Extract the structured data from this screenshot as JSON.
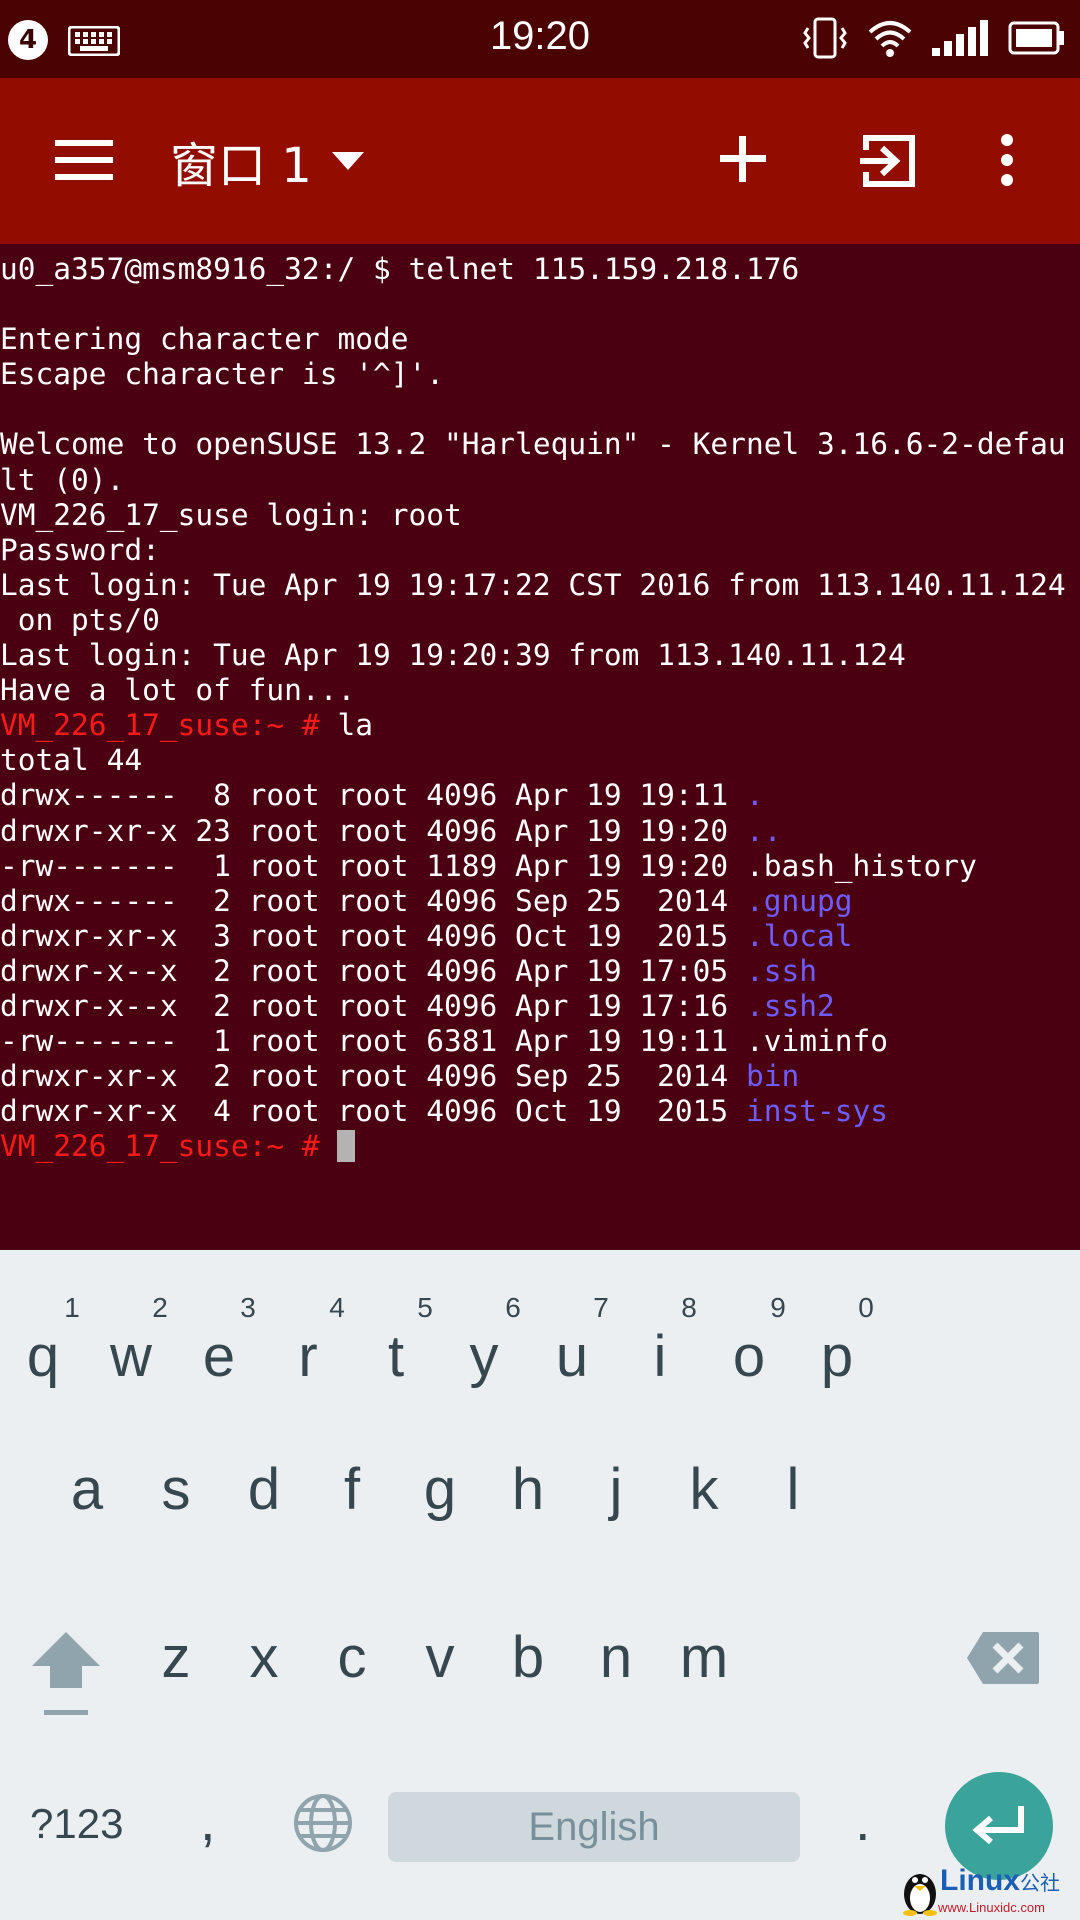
{
  "status_bar": {
    "notification_count": "4",
    "time": "19:20",
    "icons": [
      "keyboard-icon",
      "vibrate-icon",
      "wifi-icon",
      "signal-icon",
      "battery-icon"
    ]
  },
  "app_bar": {
    "window_label": "窗口 1",
    "actions": [
      "add-icon",
      "exit-icon",
      "more-icon"
    ],
    "background": "#920d00"
  },
  "terminal": {
    "background": "#4a0011",
    "prompt_color": "#ff1a1a",
    "dir_color": "#6f5cff",
    "lines": [
      {
        "text": "u0_a357@msm8916_32:/ $ telnet 115.159.218.176"
      },
      {
        "text": ""
      },
      {
        "text": "Entering character mode"
      },
      {
        "text": "Escape character is '^]'."
      },
      {
        "text": ""
      },
      {
        "text": "Welcome to openSUSE 13.2 \"Harlequin\" - Kernel 3.16.6-2-defau"
      },
      {
        "text": "lt (0)."
      },
      {
        "text": "VM_226_17_suse login: root"
      },
      {
        "text": "Password:"
      },
      {
        "text": "Last login: Tue Apr 19 19:17:22 CST 2016 from 113.140.11.124"
      },
      {
        "text": " on pts/0"
      },
      {
        "text": "Last login: Tue Apr 19 19:20:39 from 113.140.11.124"
      },
      {
        "text": "Have a lot of fun..."
      },
      {
        "prompt": "VM_226_17_suse:~ #",
        "text": " la"
      },
      {
        "text": "total 44"
      },
      {
        "text": "drwx------  8 root root 4096 Apr 19 19:11 ",
        "dir": "."
      },
      {
        "text": "drwxr-xr-x 23 root root 4096 Apr 19 19:20 ",
        "dir": ".."
      },
      {
        "text": "-rw-------  1 root root 1189 Apr 19 19:20 .bash_history"
      },
      {
        "text": "drwx------  2 root root 4096 Sep 25  2014 ",
        "dir": ".gnupg"
      },
      {
        "text": "drwxr-xr-x  3 root root 4096 Oct 19  2015 ",
        "dir": ".local"
      },
      {
        "text": "drwxr-x--x  2 root root 4096 Apr 19 17:05 ",
        "dir": ".ssh"
      },
      {
        "text": "drwxr-x--x  2 root root 4096 Apr 19 17:16 ",
        "dir": ".ssh2"
      },
      {
        "text": "-rw-------  1 root root 6381 Apr 19 19:11 .viminfo"
      },
      {
        "text": "drwxr-xr-x  2 root root 4096 Sep 25  2014 ",
        "dir": "bin"
      },
      {
        "text": "drwxr-xr-x  4 root root 4096 Oct 19  2015 ",
        "dir": "inst-sys"
      },
      {
        "prompt": "VM_226_17_suse:~ #",
        "text": " ",
        "cursor": true
      }
    ]
  },
  "keyboard": {
    "row1": [
      {
        "key": "q",
        "hint": "1"
      },
      {
        "key": "w",
        "hint": "2"
      },
      {
        "key": "e",
        "hint": "3"
      },
      {
        "key": "r",
        "hint": "4"
      },
      {
        "key": "t",
        "hint": "5"
      },
      {
        "key": "y",
        "hint": "6"
      },
      {
        "key": "u",
        "hint": "7"
      },
      {
        "key": "i",
        "hint": "8"
      },
      {
        "key": "o",
        "hint": "9"
      },
      {
        "key": "p",
        "hint": "0"
      }
    ],
    "row2": [
      "a",
      "s",
      "d",
      "f",
      "g",
      "h",
      "j",
      "k",
      "l"
    ],
    "row3": [
      "z",
      "x",
      "c",
      "v",
      "b",
      "n",
      "m"
    ],
    "symbols_label": "?123",
    "comma": ",",
    "space_label": "English",
    "period": ".",
    "enter_color": "#3aa39a"
  },
  "watermark": {
    "title": "Linux",
    "title_cn": "公社",
    "url": "www.Linuxidc.com"
  }
}
